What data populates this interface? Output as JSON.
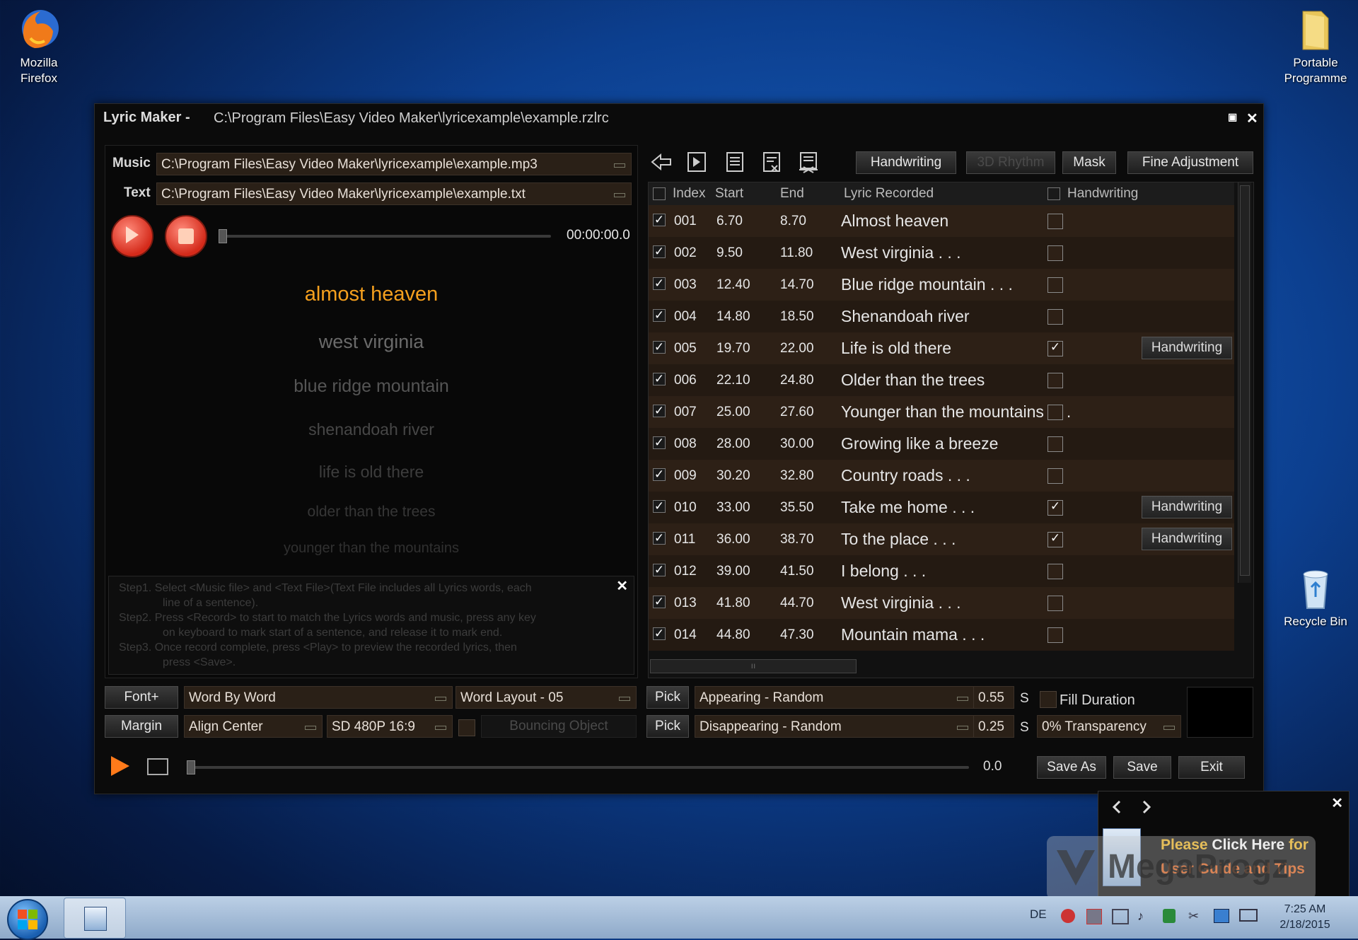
{
  "desktop": {
    "firefox_label_1": "Mozilla",
    "firefox_label_2": "Firefox",
    "portable_label_1": "Portable",
    "portable_label_2": "Programme",
    "recycle_label": "Recycle Bin"
  },
  "window": {
    "title": "Lyric Maker -",
    "path": "C:\\Program Files\\Easy Video Maker\\lyricexample\\example.rzlrc"
  },
  "files": {
    "music_label": "Music",
    "music_path": "C:\\Program Files\\Easy Video Maker\\lyricexample\\example.mp3",
    "text_label": "Text",
    "text_path": "C:\\Program Files\\Easy Video Maker\\lyricexample\\example.txt"
  },
  "player": {
    "time": "00:00:00.0"
  },
  "preview_lines": [
    {
      "text": "almost heaven"
    },
    {
      "text": "west virginia"
    },
    {
      "text": "blue ridge mountain"
    },
    {
      "text": "shenandoah river"
    },
    {
      "text": "life is old there"
    },
    {
      "text": "older than the trees"
    },
    {
      "text": "younger than the mountains"
    }
  ],
  "instructions": {
    "step1a": "Step1. Select <Music file> and <Text File>(Text File includes all Lyrics words, each",
    "step1b": "line of a sentence).",
    "step2a": "Step2. Press <Record> to start to match the Lyrics words and music, press any key",
    "step2b": "on keyboard to mark start of a sentence, and release it to mark end.",
    "step3a": "Step3. Once record complete, press <Play> to preview the recorded lyrics, then",
    "step3b": "press <Save>."
  },
  "toolbar": {
    "handwriting": "Handwriting",
    "rhythm3d": "3D Rhythm",
    "mask": "Mask",
    "fine_adjustment": "Fine Adjustment"
  },
  "table": {
    "headers": {
      "index": "Index",
      "start": "Start",
      "end": "End",
      "lyric": "Lyric Recorded",
      "handwriting": "Handwriting"
    },
    "rows": [
      {
        "index": "001",
        "start": "6.70",
        "end": "8.70",
        "lyric": "Almost heaven",
        "hw": false
      },
      {
        "index": "002",
        "start": "9.50",
        "end": "11.80",
        "lyric": "West virginia . . .",
        "hw": false
      },
      {
        "index": "003",
        "start": "12.40",
        "end": "14.70",
        "lyric": "Blue ridge mountain . . .",
        "hw": false
      },
      {
        "index": "004",
        "start": "14.80",
        "end": "18.50",
        "lyric": "Shenandoah river",
        "hw": false
      },
      {
        "index": "005",
        "start": "19.70",
        "end": "22.00",
        "lyric": "Life is old there",
        "hw": true
      },
      {
        "index": "006",
        "start": "22.10",
        "end": "24.80",
        "lyric": "Older than the trees",
        "hw": false
      },
      {
        "index": "007",
        "start": "25.00",
        "end": "27.60",
        "lyric": "Younger than the mountains . . .",
        "hw": false
      },
      {
        "index": "008",
        "start": "28.00",
        "end": "30.00",
        "lyric": "Growing like a breeze",
        "hw": false
      },
      {
        "index": "009",
        "start": "30.20",
        "end": "32.80",
        "lyric": "Country roads . . .",
        "hw": false
      },
      {
        "index": "010",
        "start": "33.00",
        "end": "35.50",
        "lyric": "Take me home . . .",
        "hw": true
      },
      {
        "index": "011",
        "start": "36.00",
        "end": "38.70",
        "lyric": "To the place . . .",
        "hw": true
      },
      {
        "index": "012",
        "start": "39.00",
        "end": "41.50",
        "lyric": "I belong . . .",
        "hw": false
      },
      {
        "index": "013",
        "start": "41.80",
        "end": "44.70",
        "lyric": "West virginia . . .",
        "hw": false
      },
      {
        "index": "014",
        "start": "44.80",
        "end": "47.30",
        "lyric": "Mountain mama . . .",
        "hw": false
      }
    ],
    "hw_button": "Handwriting"
  },
  "options": {
    "font": "Font+",
    "margin": "Margin",
    "word_mode": "Word By Word",
    "word_layout": "Word Layout - 05",
    "align": "Align Center",
    "resolution": "SD 480P 16:9",
    "bouncing": "Bouncing Object",
    "pick": "Pick",
    "appearing": "Appearing - Random",
    "disappearing": "Disappearing - Random",
    "appear_time": "0.55",
    "disappear_time": "0.25",
    "unit": "S",
    "fill_duration": "Fill Duration",
    "transparency": "0% Transparency"
  },
  "bottom": {
    "time": "0.0",
    "save_as": "Save As",
    "save": "Save",
    "exit": "Exit"
  },
  "promo": {
    "line1a": "Please",
    "line1b": "Click Here",
    "line1c": "for",
    "line2": "User Guide and Tips",
    "watermark": "MegaProgz"
  },
  "taskbar": {
    "lang": "DE",
    "time": "7:25 AM",
    "date": "2/18/2015"
  }
}
